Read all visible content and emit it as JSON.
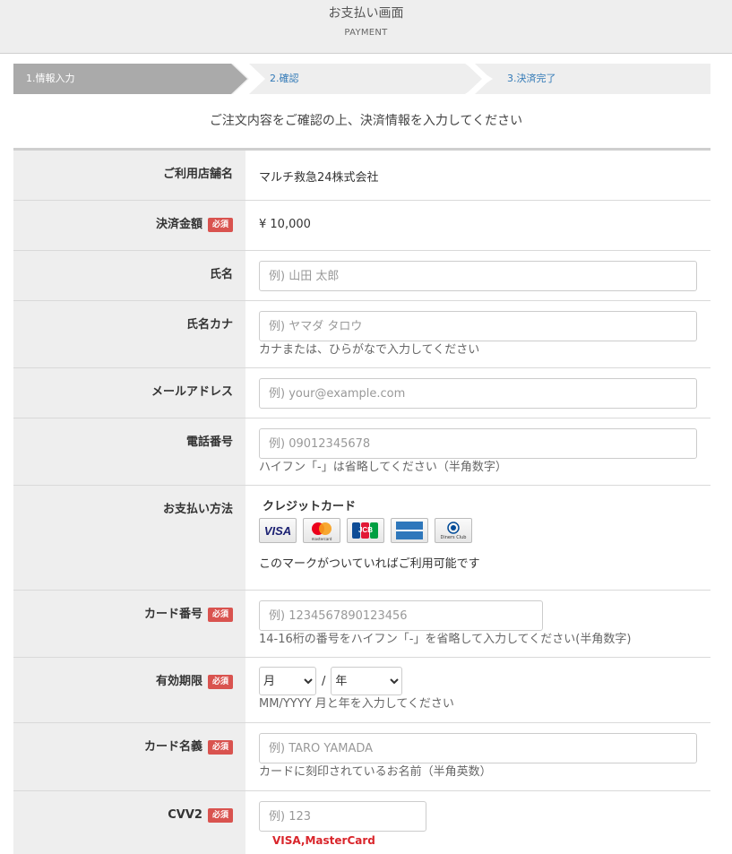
{
  "header": {
    "title": "お支払い画面",
    "subtitle": "PAYMENT"
  },
  "steps": [
    {
      "label": "1.情報入力",
      "active": true
    },
    {
      "label": "2.確認",
      "active": false
    },
    {
      "label": "3.決済完了",
      "active": false
    }
  ],
  "intro": "ご注文内容をご確認の上、決済情報を入力してください",
  "colors": {
    "active_step": "#aaaaaa",
    "inactive_step": "#eeeeee",
    "required_badge": "#d9534f",
    "label_bg": "#eeeeee"
  },
  "required_badge": "必須",
  "form": {
    "shop": {
      "label": "ご利用店舗名",
      "value": "マルチ救急24株式会社"
    },
    "amount": {
      "label": "決済金額",
      "value": "¥ 10,000"
    },
    "name": {
      "label": "氏名",
      "placeholder": "例) 山田 太郎"
    },
    "kana": {
      "label": "氏名カナ",
      "placeholder": "例) ヤマダ タロウ",
      "help": "カナまたは、ひらがなで入力してください"
    },
    "email": {
      "label": "メールアドレス",
      "placeholder": "例) your@example.com"
    },
    "phone": {
      "label": "電話番号",
      "placeholder": "例) 09012345678",
      "help": "ハイフン「-」は省略してください（半角数字）"
    },
    "payment_method": {
      "label": "お支払い方法",
      "type": "クレジットカード",
      "brands": [
        "visa-icon",
        "mastercard-icon",
        "jcb-icon",
        "amex-icon",
        "diners-club-icon"
      ],
      "brand_text": {
        "visa": "VISA",
        "mastercard": "mastercard",
        "jcb": "JCB",
        "diners": "Diners Club"
      },
      "note": "このマークがついていればご利用可能です"
    },
    "card_number": {
      "label": "カード番号",
      "placeholder": "例) 1234567890123456",
      "help": "14-16桁の番号をハイフン「-」を省略して入力してください(半角数字)"
    },
    "expiry": {
      "label": "有効期限",
      "month": "月",
      "year": "年",
      "separator": "/",
      "help": "MM/YYYY 月と年を入力してください"
    },
    "card_name": {
      "label": "カード名義",
      "placeholder": "例) TARO YAMADA",
      "help": "カードに刻印されているお名前（半角英数）"
    },
    "cvv": {
      "label": "CVV2",
      "placeholder": "例) 123",
      "note": "VISA,MasterCard"
    }
  }
}
